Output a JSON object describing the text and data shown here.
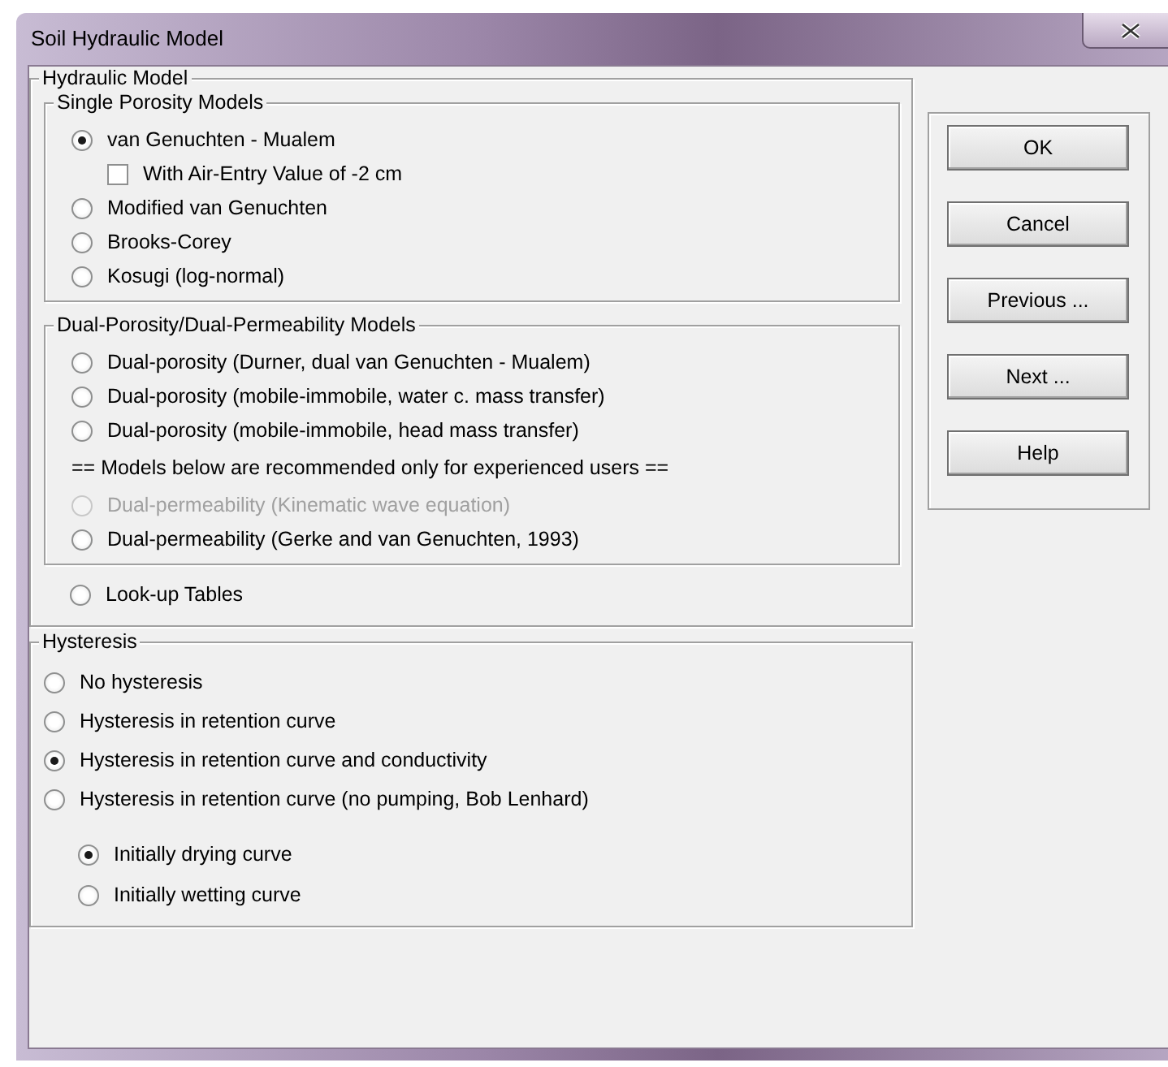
{
  "window": {
    "title": "Soil Hydraulic Model"
  },
  "hydraulic_model": {
    "title": "Hydraulic Model",
    "groups": [
      {
        "title": "Single Porosity Models",
        "items": [
          {
            "kind": "radio",
            "label": "van Genuchten - Mualem",
            "selected": true,
            "disabled": false,
            "children": [
              {
                "kind": "checkbox",
                "label": "With Air-Entry Value of -2 cm",
                "checked": false
              }
            ]
          },
          {
            "kind": "radio",
            "label": "Modified van Genuchten",
            "selected": false,
            "disabled": false
          },
          {
            "kind": "radio",
            "label": "Brooks-Corey",
            "selected": false,
            "disabled": false
          },
          {
            "kind": "radio",
            "label": "Kosugi (log-normal)",
            "selected": false,
            "disabled": false
          }
        ]
      },
      {
        "title": "Dual-Porosity/Dual-Permeability Models",
        "items": [
          {
            "kind": "radio",
            "label": "Dual-porosity (Durner, dual van Genuchten - Mualem)",
            "selected": false,
            "disabled": false
          },
          {
            "kind": "radio",
            "label": "Dual-porosity (mobile-immobile, water c. mass transfer)",
            "selected": false,
            "disabled": false
          },
          {
            "kind": "radio",
            "label": "Dual-porosity (mobile-immobile, head mass transfer)",
            "selected": false,
            "disabled": false
          },
          {
            "kind": "note",
            "label": "== Models below are recommended only for experienced users =="
          },
          {
            "kind": "radio",
            "label": "Dual-permeability (Kinematic wave equation)",
            "selected": false,
            "disabled": true
          },
          {
            "kind": "radio",
            "label": "Dual-permeability (Gerke and van Genuchten, 1993)",
            "selected": false,
            "disabled": false
          }
        ]
      }
    ],
    "items": [
      {
        "kind": "radio",
        "label": "Look-up Tables",
        "selected": false,
        "disabled": false
      }
    ]
  },
  "hysteresis": {
    "title": "Hysteresis",
    "items": [
      {
        "kind": "radio",
        "label": "No hysteresis",
        "selected": false,
        "disabled": false
      },
      {
        "kind": "radio",
        "label": "Hysteresis in retention curve",
        "selected": false,
        "disabled": false
      },
      {
        "kind": "radio",
        "label": "Hysteresis in retention curve and conductivity",
        "selected": true,
        "disabled": false
      },
      {
        "kind": "radio",
        "label": "Hysteresis in retention curve (no pumping, Bob Lenhard)",
        "selected": false,
        "disabled": false
      }
    ],
    "curve_options": [
      {
        "kind": "radio",
        "label": "Initially drying curve",
        "selected": true,
        "disabled": false
      },
      {
        "kind": "radio",
        "label": "Initially wetting curve",
        "selected": false,
        "disabled": false
      }
    ]
  },
  "buttons": [
    "OK",
    "Cancel",
    "Previous ...",
    "Next ...",
    "Help"
  ]
}
